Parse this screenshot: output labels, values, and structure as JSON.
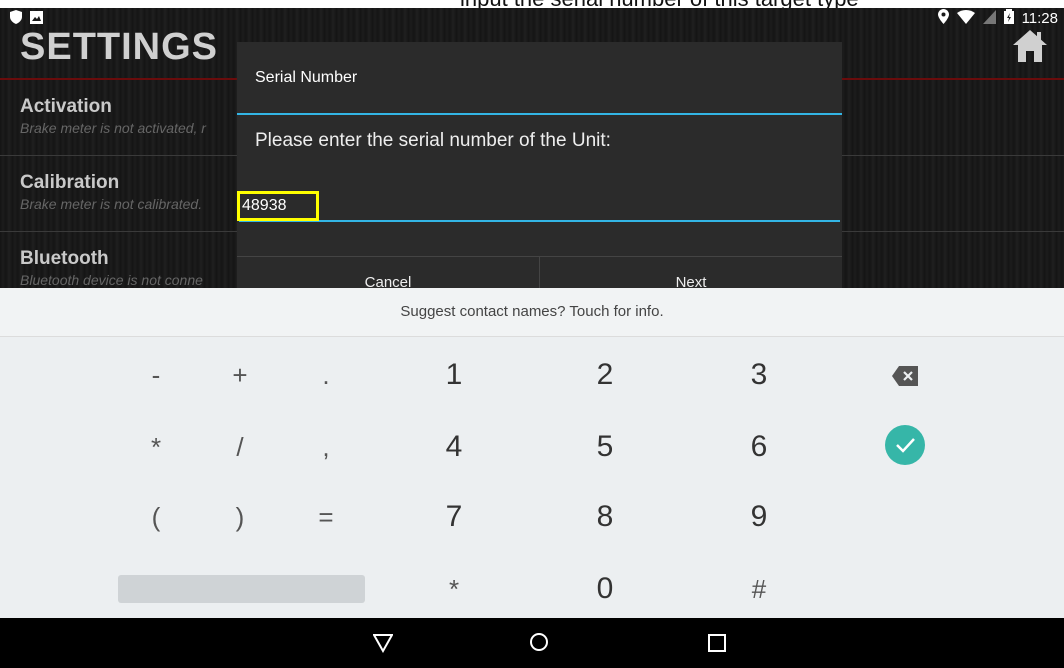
{
  "instruction_fragment": "input the serial number of this target type",
  "status_bar": {
    "time": "11:28",
    "left_icons": [
      "shield-icon",
      "image-icon"
    ],
    "right_icons": [
      "location-icon",
      "wifi-icon",
      "no-sim-icon",
      "battery-icon"
    ]
  },
  "app": {
    "title": "SETTINGS",
    "settings": [
      {
        "title": "Activation",
        "subtitle": "Brake meter is not activated, r"
      },
      {
        "title": "Calibration",
        "subtitle": "Brake meter is not calibrated."
      },
      {
        "title": "Bluetooth",
        "subtitle": "Bluetooth device is not conne"
      }
    ]
  },
  "dialog": {
    "title": "Serial Number",
    "message": "Please enter the serial number of the Unit:",
    "input_value": "48938",
    "cancel_label": "Cancel",
    "next_label": "Next"
  },
  "keyboard": {
    "suggestion": "Suggest contact names? Touch for info.",
    "rows": [
      [
        "-",
        "+",
        ".",
        "1",
        "2",
        "3"
      ],
      [
        "*",
        "/",
        ",",
        "4",
        "5",
        "6"
      ],
      [
        "(",
        ")",
        "=",
        "7",
        "8",
        "9"
      ],
      [
        "*",
        "0",
        "#"
      ]
    ]
  },
  "colors": {
    "accent": "#33b5e5",
    "highlight": "#ffff00",
    "check": "#36b6a8",
    "title_rule": "#6a0c0c"
  }
}
